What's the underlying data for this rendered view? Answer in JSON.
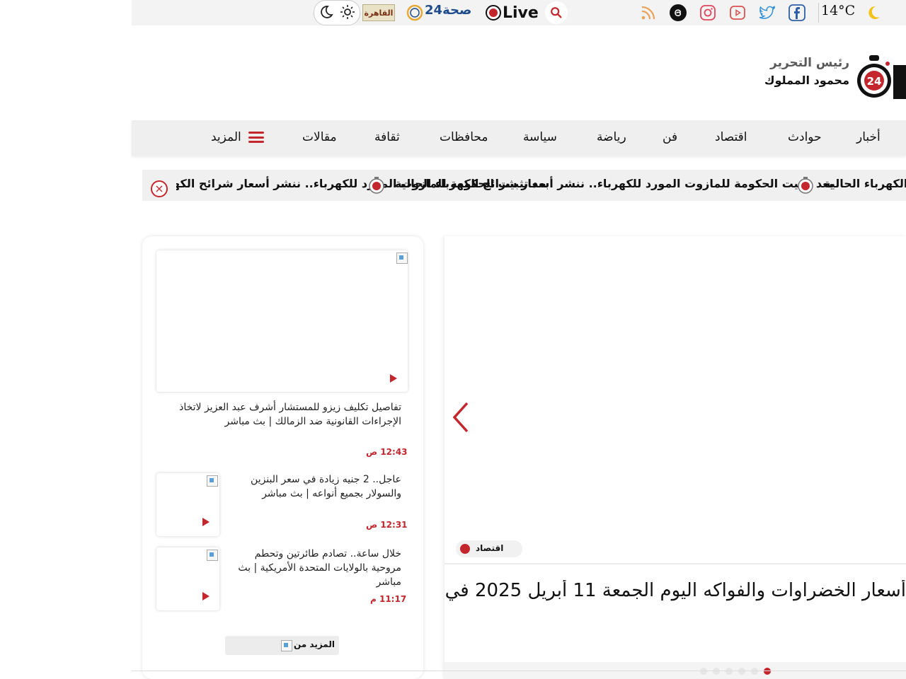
{
  "topbar": {
    "weather": "14°C",
    "live_label": "Live",
    "seha_label": "صحة24",
    "cairo_label": "القاهرة"
  },
  "header": {
    "editor_title": "رئيس التحرير",
    "editor_name": "محمود المملوك"
  },
  "nav": {
    "items": [
      "أخبار",
      "حوادث",
      "اقتصاد",
      "فن",
      "رياضة",
      "سياسة",
      "محافظات",
      "ثقافة",
      "مقالات"
    ],
    "more_label": "المزيد"
  },
  "ticker": {
    "items": [
      "بعد تثبيت الحكومة للمازوت المورد للكهرباء.. ننشر أسعار شرائح الكهرباء الحالية",
      "بعد تثبيت الحكومة للمازوت المورد للكهرباء.. ننشر أسعار شرائح الكهرباء الحالية"
    ],
    "close_symbol": "×"
  },
  "card": {
    "featured": {
      "title": "تفاصيل تكليف زيزو للمستشار أشرف عبد العزيز لاتخاذ الإجراءات القانونية ضد الزمالك | بث مباشر",
      "time": "12:43 ص"
    },
    "items": [
      {
        "title": "عاجل.. 2 جنيه زيادة في سعر البنزين والسولار بجميع أنواعه | بث مباشر",
        "time": "12:31 ص"
      },
      {
        "title": "خلال ساعة.. تصادم طائرتين وتحطم مروحية بالولايات المتحدة الأمريكية | بث مباشر",
        "time": "11:17 م"
      }
    ],
    "more_label": "المزيد من"
  },
  "slider": {
    "category": "اقتصاد",
    "headline": "أسعار الخضراوات والفواكه اليوم الجمعة 11 أبريل 2025 في",
    "dots_count": 6,
    "active_dot": 5
  },
  "colors": {
    "accent": "#c3272d",
    "topbar_bg": "#f3f3f3",
    "nav_bg": "#efefef"
  }
}
